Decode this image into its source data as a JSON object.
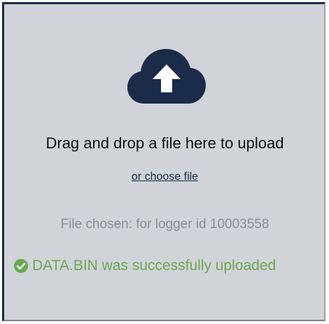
{
  "upload": {
    "icon": "cloud-upload-icon",
    "drop_text": "Drag and drop a file here to upload",
    "choose_link": "or choose file",
    "file_chosen": "File chosen: for logger id 10003558",
    "success_icon": "check-circle-icon",
    "success_text": "DATA.BIN was successfully uploaded"
  },
  "colors": {
    "background": "#d0d3d8",
    "border": "#1b2b4a",
    "cloud": "#1b2b4a",
    "success": "#6aa84f",
    "muted_text": "#8a8e94"
  }
}
